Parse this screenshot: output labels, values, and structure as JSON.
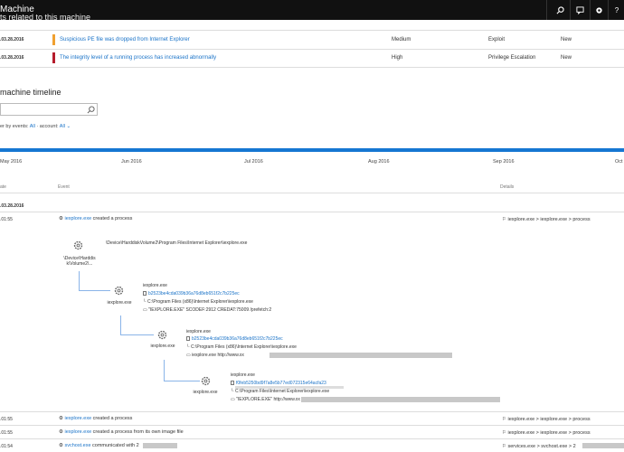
{
  "topbar": {
    "title": "Machine"
  },
  "alerts": {
    "heading": "ts related to this machine",
    "rows": [
      {
        "date": ".03.28.2016",
        "title": "Suspicious PE file was dropped from Internet Explorer",
        "severity": "Medium",
        "category": "Exploit",
        "status": "New",
        "color": "#f0a030"
      },
      {
        "date": ".03.28.2016",
        "title": "The integrity level of a running process has increased abnormally",
        "severity": "High",
        "category": "Privilege Escalation",
        "status": "New",
        "color": "#b51c2c"
      }
    ]
  },
  "timeline": {
    "heading": "machine timeline",
    "filter_prefix": "er by events:",
    "filter_events": "All",
    "filter_mid": "· account:",
    "filter_account": "All",
    "months": [
      "May 2016",
      "Jun 2016",
      "Jul 2016",
      "Aug 2016",
      "Sep 2016",
      "Oct"
    ],
    "accent": "#1677d2"
  },
  "columns": {
    "date": "ate",
    "event": "Event",
    "details": "Details"
  },
  "group_date": ".03.28.2016",
  "events": [
    {
      "time": ".01:55",
      "link": "iexplore.exe",
      "text": " created a process",
      "details": "iexplore.exe > iexplore.exe > process"
    },
    {
      "time": ".01:55",
      "link": "iexplore.exe",
      "text": " created a process",
      "details": "iexplore.exe > iexplore.exe > process"
    },
    {
      "time": ".01:55",
      "link": "iexplore.exe",
      "text": " created a process from its own image file",
      "details": "iexplore.exe > iexplore.exe > process"
    },
    {
      "time": ".01:54",
      "link": "svchost.exe",
      "text": " communicated with 2",
      "details": "services.exe > svchost.exe > 2"
    }
  ],
  "tree": {
    "root_path": "\\Device\\HarddiskVolume2\\Program Files\\Internet Explorer\\iexplore.exe",
    "root_label": "\\Device\\Harddis\n k\\Volume2\\...",
    "n1": {
      "label": "iexplore.exe",
      "name": "iexplore.exe",
      "hash": "b2523be4cda039b36a76d8eb651f2c7b225ec",
      "path": "C:\\Program Files (x86)\\Internet Explorer\\iexplore.exe",
      "cmd": "\"IEXPLORE.EXE\" SCODEF:2912 CREDAT:75009 /prefetch:2"
    },
    "n2": {
      "label": "iexplore.exe",
      "name": "iexplore.exe",
      "hash": "b2523be4cda039b36a76d8eb651f2c7b225ec",
      "path": "C:\\Program Files (x86)\\Internet Explorer\\iexplore.exe",
      "cmd": "iexplore.exe http://www.xx"
    },
    "n3": {
      "label": "iexplore.exe",
      "name": "iexplore.exe",
      "hash": "f0feb5250bd9f7a8e5b77ed072315e64acfa23",
      "path": "C:\\Program Files\\Internet Explorer\\iexplore.exe",
      "cmd": "\"IEXPLORE.EXE\" http://www.xx"
    }
  }
}
